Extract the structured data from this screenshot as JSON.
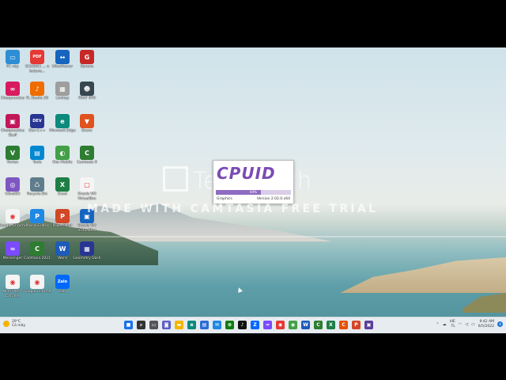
{
  "desktop": {
    "icons": [
      {
        "label": "PC này",
        "color": "#2d8ed6",
        "glyph": "▭"
      },
      {
        "label": "5/1/2021 ... n lecture...",
        "color": "#e53935",
        "glyph": "PDF"
      },
      {
        "label": "UltraViewer",
        "color": "#1565c0",
        "glyph": "↔"
      },
      {
        "label": "Garena",
        "color": "#c62828",
        "glyph": "G"
      },
      {
        "label": "Cheopractice",
        "color": "#d81b60",
        "glyph": "∞"
      },
      {
        "label": "FL Studio 20",
        "color": "#ef6c00",
        "glyph": "♪"
      },
      {
        "label": "Lichtop",
        "color": "#9e9e9e",
        "glyph": "▦"
      },
      {
        "label": "FNAF PPO",
        "color": "#37474f",
        "glyph": "☻"
      },
      {
        "label": "Cheopractice Stuff",
        "color": "#c2185b",
        "glyph": "▣"
      },
      {
        "label": "Dev-C++",
        "color": "#283593",
        "glyph": "DEV"
      },
      {
        "label": "Microsoft Edge",
        "color": "#0c8a7c",
        "glyph": "e"
      },
      {
        "label": "Brave",
        "color": "#e0521f",
        "glyph": "▼"
      },
      {
        "label": "Vortex",
        "color": "#2e7d32",
        "glyph": "V"
      },
      {
        "label": "Tools",
        "color": "#0288d1",
        "glyph": "▤"
      },
      {
        "label": "Nox Mobile",
        "color": "#43a047",
        "glyph": "◐"
      },
      {
        "label": "Camtasia 9",
        "color": "#2e7d32",
        "glyph": "C"
      },
      {
        "label": "UltraISO",
        "color": "#7e57c2",
        "glyph": "◎"
      },
      {
        "label": "Recycle Bin",
        "color": "#607d8b",
        "glyph": "♺"
      },
      {
        "label": "Excel",
        "color": "#1e7e45",
        "glyph": "X"
      },
      {
        "label": "Oracle VM VirtualBox",
        "color": "#f5f5f5",
        "glyph": "▢"
      },
      {
        "label": "Google Chrome",
        "color": "#f4f4f4",
        "glyph": "◉"
      },
      {
        "label": "Pascal Editor",
        "color": "#1e88e5",
        "glyph": "P"
      },
      {
        "label": "PowerPoint",
        "color": "#d24726",
        "glyph": "P"
      },
      {
        "label": "Oracle VM VirtualBox",
        "color": "#1565c0",
        "glyph": "▣"
      },
      {
        "label": "Messenger",
        "color": "#7b4bff",
        "glyph": "≈"
      },
      {
        "label": "Camtasia 2021",
        "color": "#2e7d32",
        "glyph": "C"
      },
      {
        "label": "Word",
        "color": "#1e5bb8",
        "glyph": "W"
      },
      {
        "label": "Geometry Dash",
        "color": "#283593",
        "glyph": "▦"
      },
      {
        "label": "Minh Hiếu - Chrome",
        "color": "#f4f4f4",
        "glyph": "◉"
      },
      {
        "label": "Google Chrome",
        "color": "#f4f4f4",
        "glyph": "◉"
      },
      {
        "label": "Zalo",
        "color": "#0068ff",
        "glyph": "Zalo"
      }
    ]
  },
  "splash": {
    "logo": "CPUID",
    "progress_label": "60%",
    "progress": 0.6,
    "left_text": "Graphics",
    "version": "Version 2.02.0.x64"
  },
  "watermark": {
    "brand": "Techsmith",
    "trial": "MADE WITH CAMTASIA FREE TRIAL"
  },
  "taskbar": {
    "weather_temp": "29°C",
    "weather_desc": "Có mây",
    "apps": [
      {
        "name": "start",
        "color": "#1a73e8",
        "glyph": "■"
      },
      {
        "name": "search",
        "color": "#333333",
        "glyph": "⌕"
      },
      {
        "name": "task-view",
        "color": "#555555",
        "glyph": "▭"
      },
      {
        "name": "chat",
        "color": "#5b5fc7",
        "glyph": "◙"
      },
      {
        "name": "file-explorer",
        "color": "#f2b600",
        "glyph": "▬"
      },
      {
        "name": "edge",
        "color": "#0c8a7c",
        "glyph": "e"
      },
      {
        "name": "store",
        "color": "#2b6cd6",
        "glyph": "▤"
      },
      {
        "name": "mail",
        "color": "#1e88e5",
        "glyph": "✉"
      },
      {
        "name": "xbox",
        "color": "#107c10",
        "glyph": "⊗"
      },
      {
        "name": "tiktok",
        "color": "#111111",
        "glyph": "♪"
      },
      {
        "name": "zalo",
        "color": "#0068ff",
        "glyph": "Z"
      },
      {
        "name": "messenger",
        "color": "#7b4bff",
        "glyph": "≈"
      },
      {
        "name": "chrome",
        "color": "#e53935",
        "glyph": "◉"
      },
      {
        "name": "chrome-2",
        "color": "#43a047",
        "glyph": "◉"
      },
      {
        "name": "word",
        "color": "#1e5bb8",
        "glyph": "W"
      },
      {
        "name": "camtasia",
        "color": "#2e7d32",
        "glyph": "C"
      },
      {
        "name": "excel",
        "color": "#1e7e45",
        "glyph": "X"
      },
      {
        "name": "camtasia-2",
        "color": "#e65100",
        "glyph": "C"
      },
      {
        "name": "powerpoint",
        "color": "#d24726",
        "glyph": "P"
      },
      {
        "name": "cpuid",
        "color": "#5a3f9b",
        "glyph": "▣"
      }
    ],
    "lang": "VIE",
    "lang2": "TL",
    "time": "9:42 AM",
    "date": "6/5/2022",
    "notif_count": "4"
  }
}
